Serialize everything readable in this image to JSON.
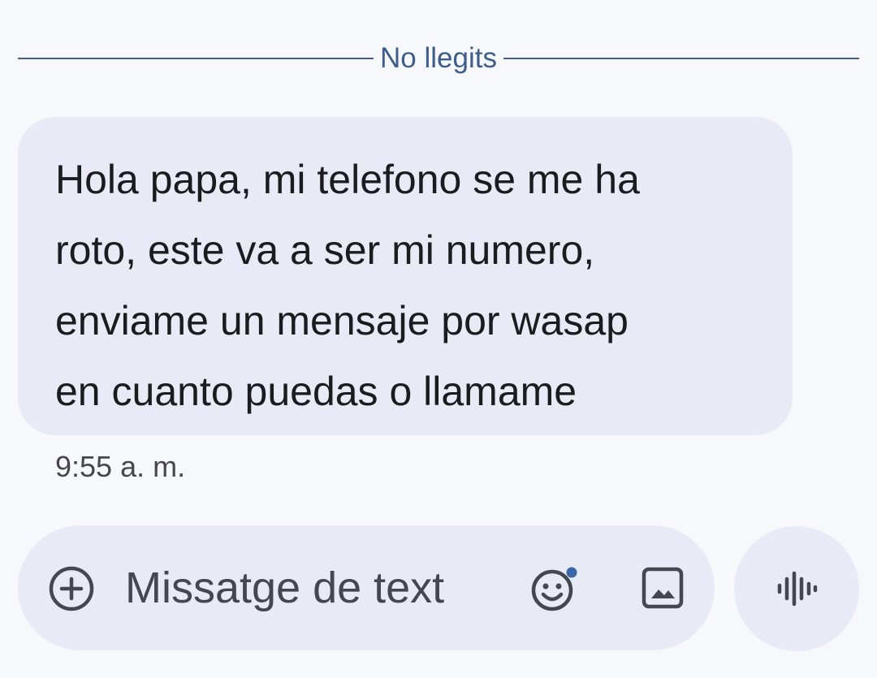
{
  "divider": {
    "label": "No llegits"
  },
  "message": {
    "lines": [
      "Hola papa, mi telefono se me ha",
      "roto, este va a ser mi numero,",
      "enviame un mensaje por wasap",
      "en cuanto puedas o llamame"
    ],
    "timestamp": "9:55 a. m."
  },
  "composer": {
    "placeholder": "Missatge de text",
    "icons": {
      "add": "add-circle-icon",
      "emoji": "emoji-icon",
      "gallery": "image-icon",
      "voice": "voice-waveform-icon"
    },
    "notification_dot_color": "#3d66a8"
  },
  "colors": {
    "background": "#f6f8fc",
    "bubble": "#e8eaf5",
    "divider": "#44608a",
    "text": "#1b1c20",
    "secondary_text": "#44474f"
  }
}
